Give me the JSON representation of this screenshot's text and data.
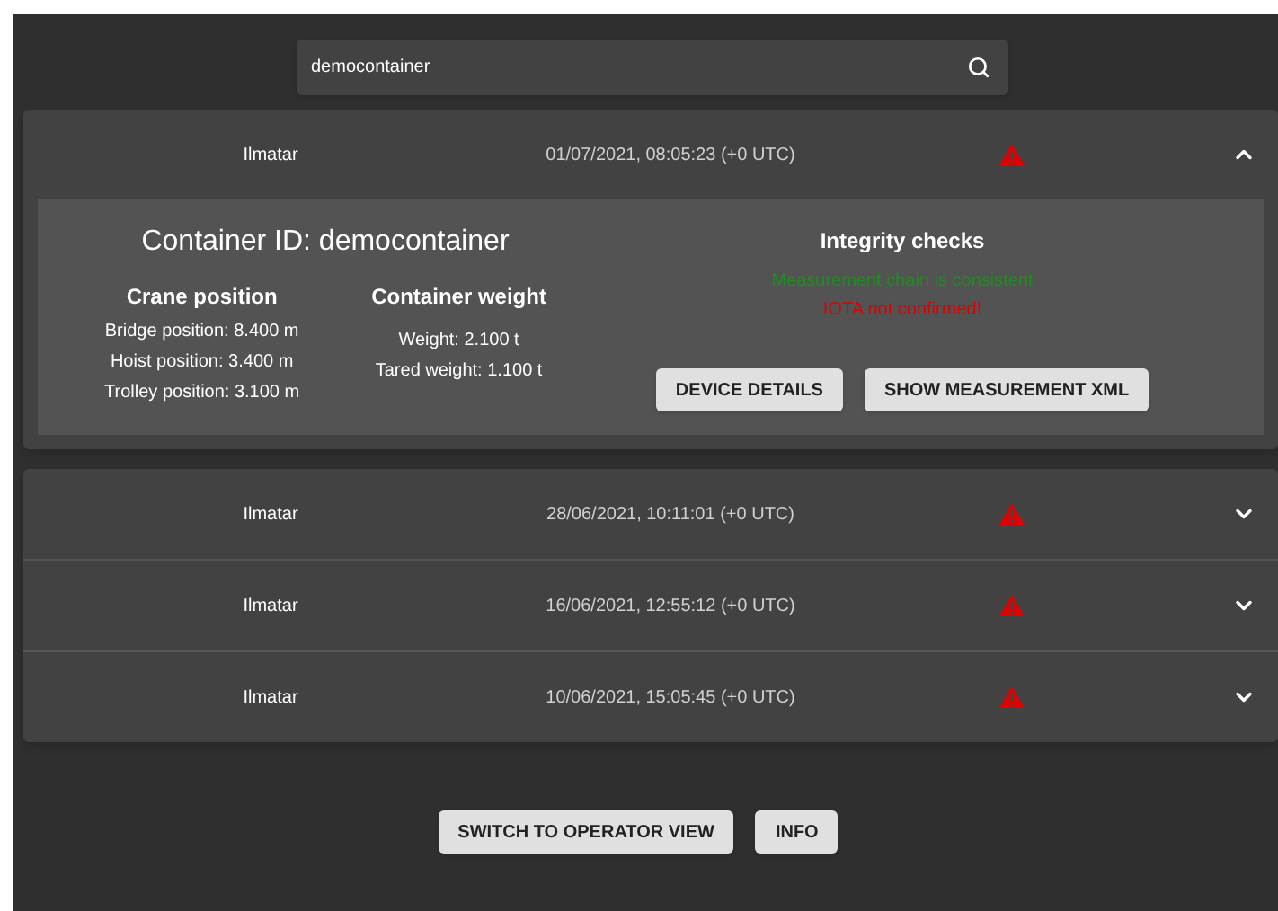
{
  "search": {
    "value": "democontainer"
  },
  "records": [
    {
      "device": "Ilmatar",
      "timestamp": "01/07/2021, 08:05:23 (+0 UTC)",
      "warning": true,
      "expanded": true,
      "details": {
        "title": "Container ID: democontainer",
        "crane": {
          "heading": "Crane position",
          "lines": [
            "Bridge position: 8.400 m",
            "Hoist position: 3.400 m",
            "Trolley position: 3.100 m"
          ]
        },
        "weight": {
          "heading": "Container weight",
          "lines": [
            "Weight: 2.100 t",
            "Tared weight: 1.100 t"
          ]
        },
        "integrity": {
          "heading": "Integrity checks",
          "checks": [
            {
              "text": "Measurement chain is consistent",
              "color": "#1e8f1e"
            },
            {
              "text": "IOTA not confirmed!",
              "color": "#e00000"
            }
          ]
        },
        "buttons": [
          "DEVICE DETAILS",
          "SHOW MEASUREMENT XML"
        ]
      }
    },
    {
      "device": "Ilmatar",
      "timestamp": "28/06/2021, 10:11:01 (+0 UTC)",
      "warning": true,
      "expanded": false
    },
    {
      "device": "Ilmatar",
      "timestamp": "16/06/2021, 12:55:12 (+0 UTC)",
      "warning": true,
      "expanded": false
    },
    {
      "device": "Ilmatar",
      "timestamp": "10/06/2021, 15:05:45 (+0 UTC)",
      "warning": true,
      "expanded": false
    }
  ],
  "footer_buttons": [
    "SWITCH TO OPERATOR VIEW",
    "INFO"
  ]
}
